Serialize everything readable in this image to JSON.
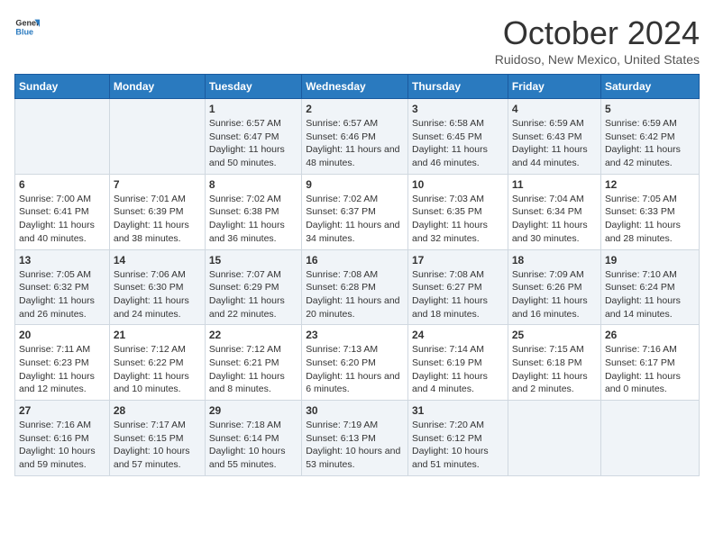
{
  "logo": {
    "text_general": "General",
    "text_blue": "Blue"
  },
  "header": {
    "month": "October 2024",
    "location": "Ruidoso, New Mexico, United States"
  },
  "weekdays": [
    "Sunday",
    "Monday",
    "Tuesday",
    "Wednesday",
    "Thursday",
    "Friday",
    "Saturday"
  ],
  "weeks": [
    [
      {
        "day": "",
        "content": ""
      },
      {
        "day": "",
        "content": ""
      },
      {
        "day": "1",
        "content": "Sunrise: 6:57 AM\nSunset: 6:47 PM\nDaylight: 11 hours and 50 minutes."
      },
      {
        "day": "2",
        "content": "Sunrise: 6:57 AM\nSunset: 6:46 PM\nDaylight: 11 hours and 48 minutes."
      },
      {
        "day": "3",
        "content": "Sunrise: 6:58 AM\nSunset: 6:45 PM\nDaylight: 11 hours and 46 minutes."
      },
      {
        "day": "4",
        "content": "Sunrise: 6:59 AM\nSunset: 6:43 PM\nDaylight: 11 hours and 44 minutes."
      },
      {
        "day": "5",
        "content": "Sunrise: 6:59 AM\nSunset: 6:42 PM\nDaylight: 11 hours and 42 minutes."
      }
    ],
    [
      {
        "day": "6",
        "content": "Sunrise: 7:00 AM\nSunset: 6:41 PM\nDaylight: 11 hours and 40 minutes."
      },
      {
        "day": "7",
        "content": "Sunrise: 7:01 AM\nSunset: 6:39 PM\nDaylight: 11 hours and 38 minutes."
      },
      {
        "day": "8",
        "content": "Sunrise: 7:02 AM\nSunset: 6:38 PM\nDaylight: 11 hours and 36 minutes."
      },
      {
        "day": "9",
        "content": "Sunrise: 7:02 AM\nSunset: 6:37 PM\nDaylight: 11 hours and 34 minutes."
      },
      {
        "day": "10",
        "content": "Sunrise: 7:03 AM\nSunset: 6:35 PM\nDaylight: 11 hours and 32 minutes."
      },
      {
        "day": "11",
        "content": "Sunrise: 7:04 AM\nSunset: 6:34 PM\nDaylight: 11 hours and 30 minutes."
      },
      {
        "day": "12",
        "content": "Sunrise: 7:05 AM\nSunset: 6:33 PM\nDaylight: 11 hours and 28 minutes."
      }
    ],
    [
      {
        "day": "13",
        "content": "Sunrise: 7:05 AM\nSunset: 6:32 PM\nDaylight: 11 hours and 26 minutes."
      },
      {
        "day": "14",
        "content": "Sunrise: 7:06 AM\nSunset: 6:30 PM\nDaylight: 11 hours and 24 minutes."
      },
      {
        "day": "15",
        "content": "Sunrise: 7:07 AM\nSunset: 6:29 PM\nDaylight: 11 hours and 22 minutes."
      },
      {
        "day": "16",
        "content": "Sunrise: 7:08 AM\nSunset: 6:28 PM\nDaylight: 11 hours and 20 minutes."
      },
      {
        "day": "17",
        "content": "Sunrise: 7:08 AM\nSunset: 6:27 PM\nDaylight: 11 hours and 18 minutes."
      },
      {
        "day": "18",
        "content": "Sunrise: 7:09 AM\nSunset: 6:26 PM\nDaylight: 11 hours and 16 minutes."
      },
      {
        "day": "19",
        "content": "Sunrise: 7:10 AM\nSunset: 6:24 PM\nDaylight: 11 hours and 14 minutes."
      }
    ],
    [
      {
        "day": "20",
        "content": "Sunrise: 7:11 AM\nSunset: 6:23 PM\nDaylight: 11 hours and 12 minutes."
      },
      {
        "day": "21",
        "content": "Sunrise: 7:12 AM\nSunset: 6:22 PM\nDaylight: 11 hours and 10 minutes."
      },
      {
        "day": "22",
        "content": "Sunrise: 7:12 AM\nSunset: 6:21 PM\nDaylight: 11 hours and 8 minutes."
      },
      {
        "day": "23",
        "content": "Sunrise: 7:13 AM\nSunset: 6:20 PM\nDaylight: 11 hours and 6 minutes."
      },
      {
        "day": "24",
        "content": "Sunrise: 7:14 AM\nSunset: 6:19 PM\nDaylight: 11 hours and 4 minutes."
      },
      {
        "day": "25",
        "content": "Sunrise: 7:15 AM\nSunset: 6:18 PM\nDaylight: 11 hours and 2 minutes."
      },
      {
        "day": "26",
        "content": "Sunrise: 7:16 AM\nSunset: 6:17 PM\nDaylight: 11 hours and 0 minutes."
      }
    ],
    [
      {
        "day": "27",
        "content": "Sunrise: 7:16 AM\nSunset: 6:16 PM\nDaylight: 10 hours and 59 minutes."
      },
      {
        "day": "28",
        "content": "Sunrise: 7:17 AM\nSunset: 6:15 PM\nDaylight: 10 hours and 57 minutes."
      },
      {
        "day": "29",
        "content": "Sunrise: 7:18 AM\nSunset: 6:14 PM\nDaylight: 10 hours and 55 minutes."
      },
      {
        "day": "30",
        "content": "Sunrise: 7:19 AM\nSunset: 6:13 PM\nDaylight: 10 hours and 53 minutes."
      },
      {
        "day": "31",
        "content": "Sunrise: 7:20 AM\nSunset: 6:12 PM\nDaylight: 10 hours and 51 minutes."
      },
      {
        "day": "",
        "content": ""
      },
      {
        "day": "",
        "content": ""
      }
    ]
  ]
}
